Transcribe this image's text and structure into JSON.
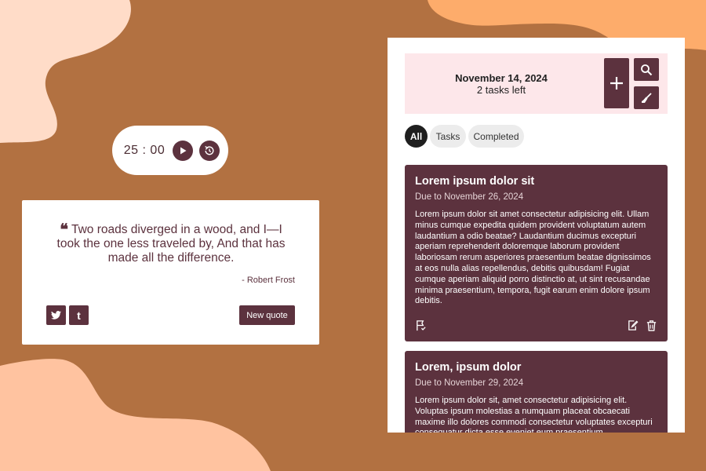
{
  "colors": {
    "background": "#b27141",
    "accent": "#5c323e",
    "blob_peach": "#ffdcc8",
    "blob_orange": "#fdac6b",
    "header_pink": "#fde7ea"
  },
  "timer": {
    "time": "25 : 00",
    "play_icon": "play-icon",
    "reset_icon": "timer-reset-icon"
  },
  "quote": {
    "text": "Two roads diverged in a wood, and I—I took the one less traveled by, And that has made all the difference.",
    "author": "- Robert Frost",
    "new_quote_label": "New quote",
    "share_icons": [
      "twitter-icon",
      "tumblr-icon"
    ]
  },
  "todo": {
    "date": "November 14, 2024",
    "tasks_left": "2 tasks left",
    "buttons": [
      "plus-icon",
      "search-icon",
      "broom-icon"
    ],
    "filters": [
      "All",
      "Tasks",
      "Completed"
    ],
    "active_filter": "All",
    "tasks": [
      {
        "title": "Lorem ipsum dolor sit",
        "due": "Due to November 26, 2024",
        "body": "Lorem ipsum dolor sit amet consectetur adipisicing elit. Ullam minus cumque expedita quidem provident voluptatum autem laudantium a odio beatae? Laudantium ducimus excepturi aperiam reprehenderit doloremque laborum provident laboriosam rerum asperiores praesentium beatae dignissimos at eos nulla alias repellendus, debitis quibusdam! Fugiat cumque aperiam aliquid porro distinctio at, ut sint recusandae minima praesentium, tempora, fugit earum enim dolore ipsum debitis."
      },
      {
        "title": "Lorem, ipsum dolor",
        "due": "Due to November 29, 2024",
        "body": "Lorem ipsum dolor sit, amet consectetur adipisicing elit. Voluptas ipsum molestias a numquam placeat obcaecati maxime illo dolores commodi consectetur voluptates excepturi consequatur dicta esse eveniet eum praesentium"
      }
    ]
  }
}
